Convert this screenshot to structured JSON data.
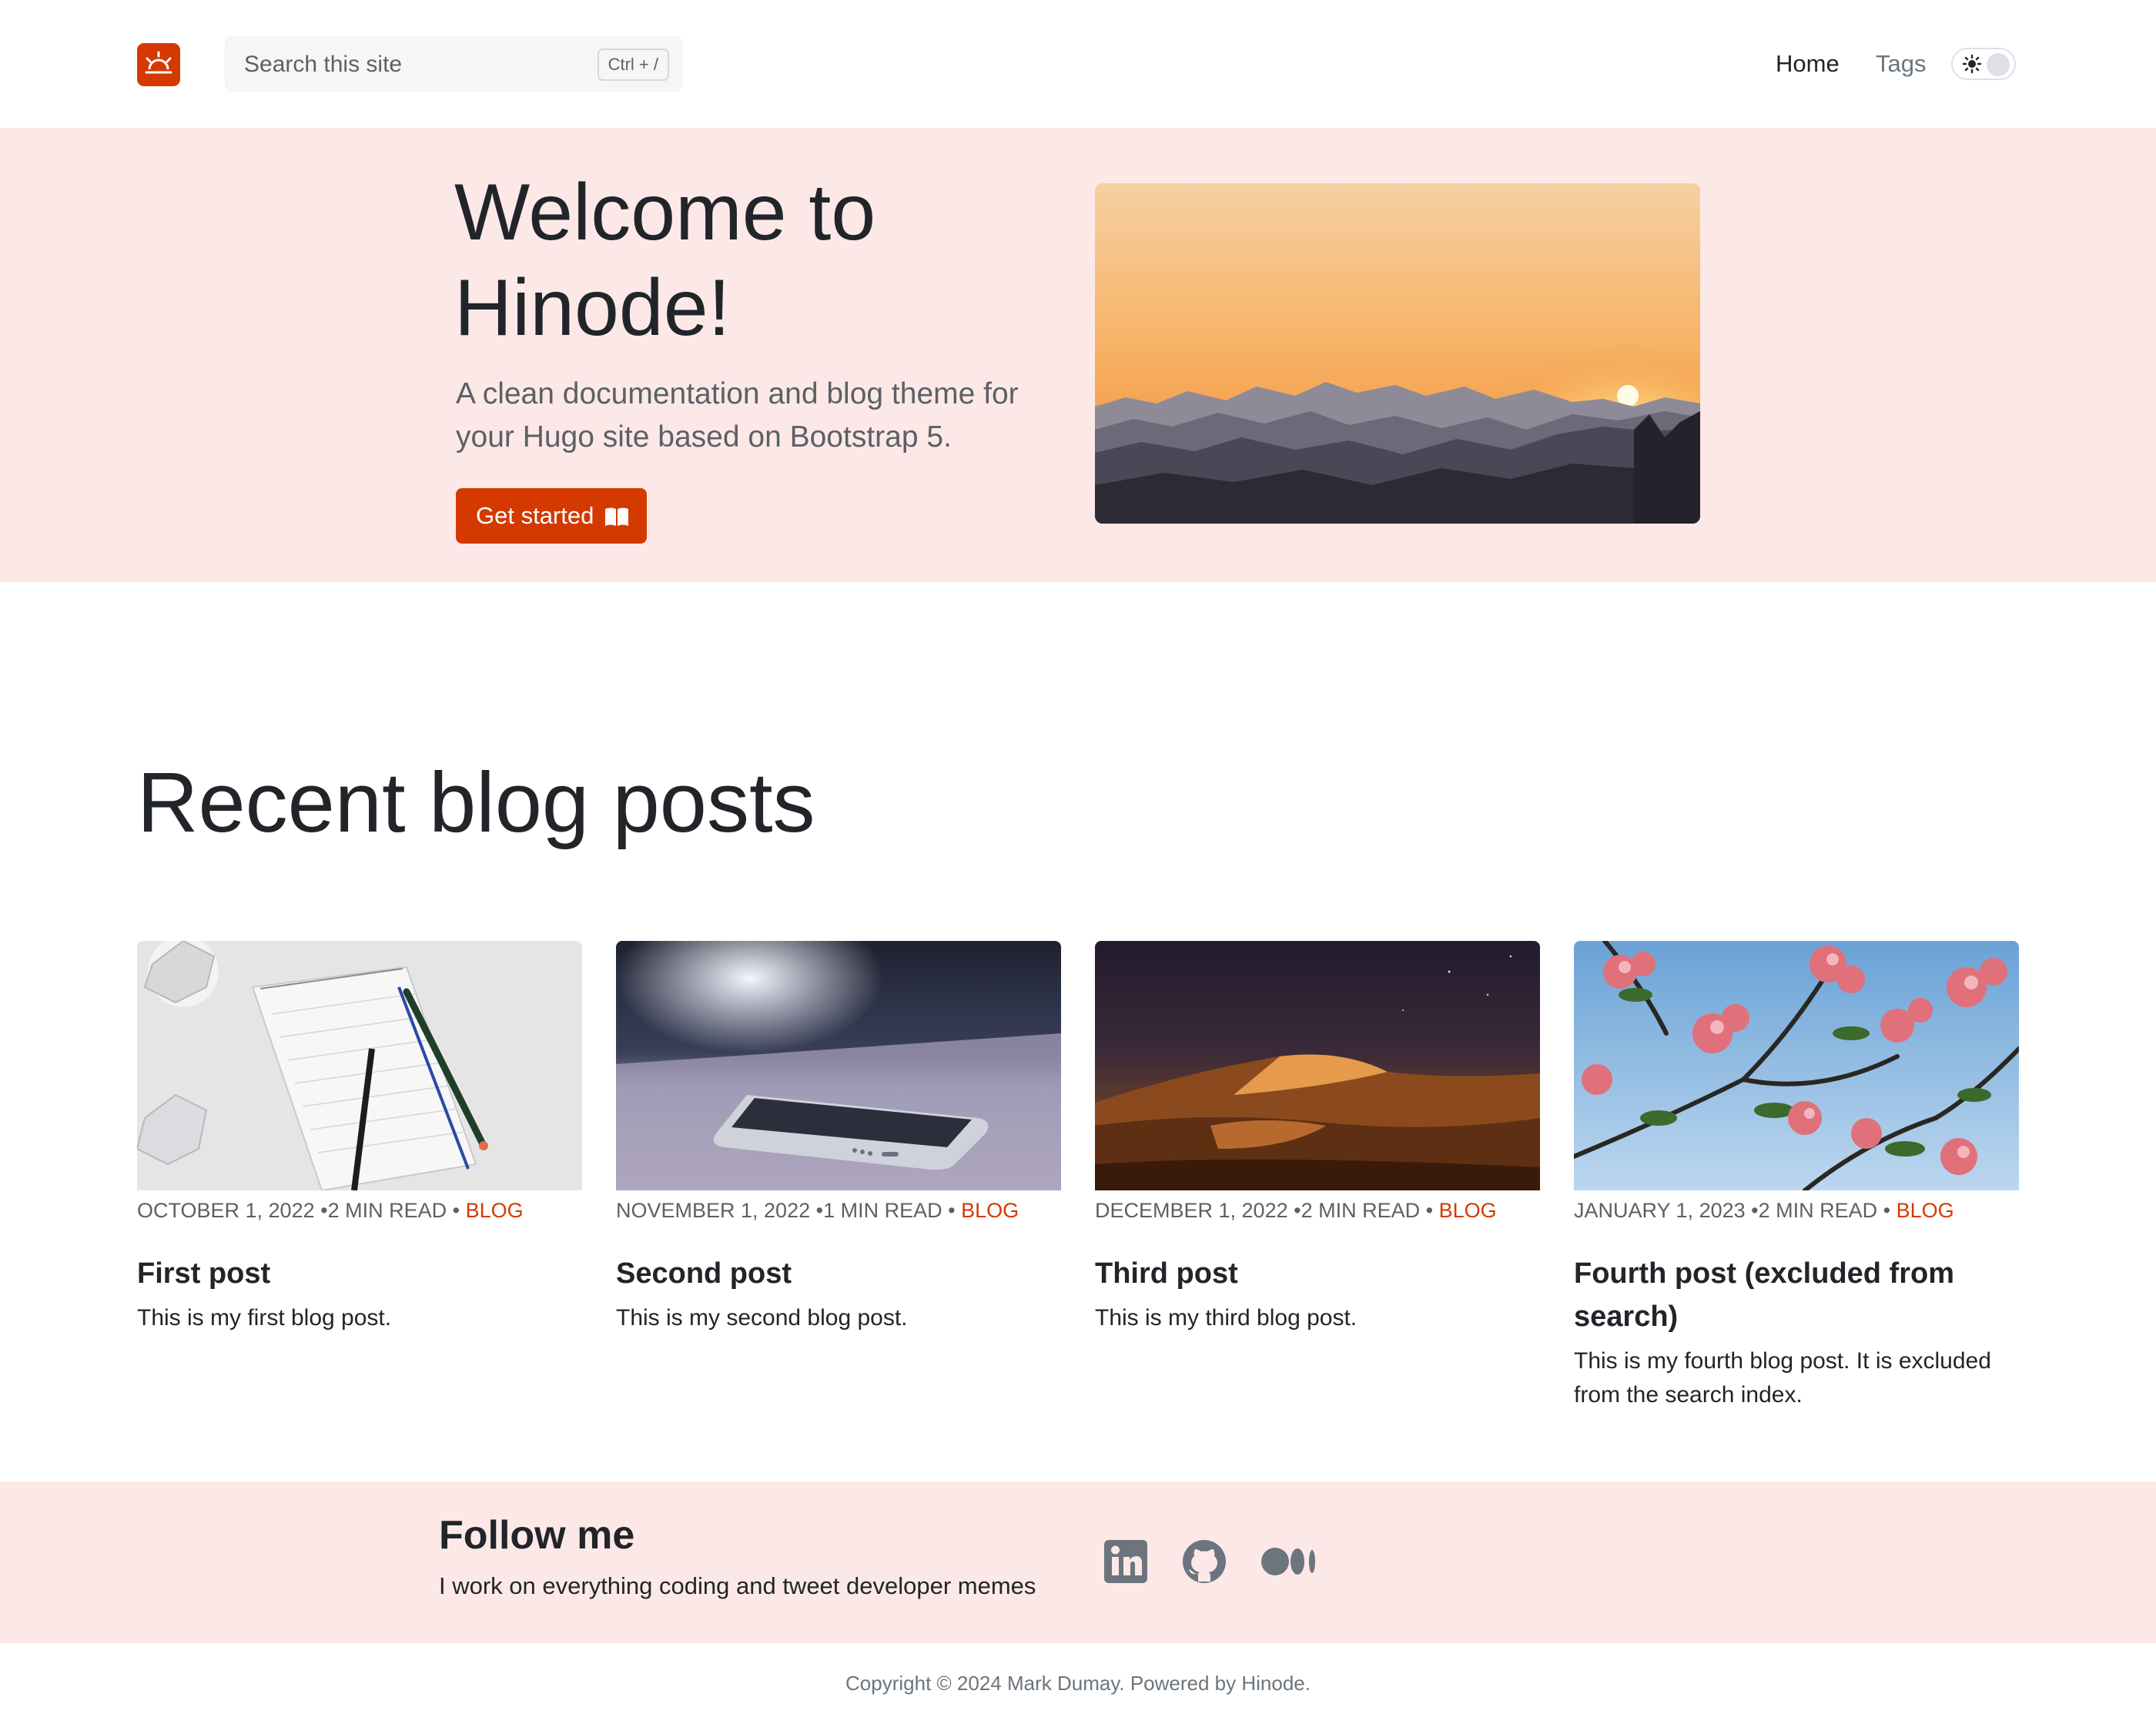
{
  "header": {
    "search_placeholder": "Search this site",
    "search_shortcut": "Ctrl + /",
    "nav": [
      {
        "label": "Home"
      },
      {
        "label": "Tags"
      }
    ],
    "brand_color": "#d43900"
  },
  "hero": {
    "title": "Welcome to Hinode!",
    "subtitle": "A clean documentation and blog theme for your Hugo site based on Bootstrap 5.",
    "button_label": "Get started",
    "background": "#fce9e7"
  },
  "recent": {
    "title": "Recent blog posts",
    "posts": [
      {
        "date": "OCTOBER 1, 2022",
        "read": "2 MIN READ",
        "tag": "BLOG",
        "title": "First post",
        "description": "This is my first blog post.",
        "image_icon": "notebook-image"
      },
      {
        "date": "NOVEMBER 1, 2022",
        "read": "1 MIN READ",
        "tag": "BLOG",
        "title": "Second post",
        "description": "This is my second blog post.",
        "image_icon": "phone-image"
      },
      {
        "date": "DECEMBER 1, 2022",
        "read": "2 MIN READ",
        "tag": "BLOG",
        "title": "Third post",
        "description": "This is my third blog post.",
        "image_icon": "desert-image"
      },
      {
        "date": "JANUARY 1, 2023",
        "read": "2 MIN READ",
        "tag": "BLOG",
        "title": "Fourth post (excluded from search)",
        "description": "This is my fourth blog post. It is excluded from the search index.",
        "image_icon": "blossom-image"
      }
    ]
  },
  "follow": {
    "title": "Follow me",
    "subtitle": "I work on everything coding and tweet developer memes",
    "icons": [
      "linkedin-icon",
      "github-icon",
      "medium-icon"
    ]
  },
  "footer": {
    "text": "Copyright © 2024 Mark Dumay. Powered by Hinode."
  }
}
